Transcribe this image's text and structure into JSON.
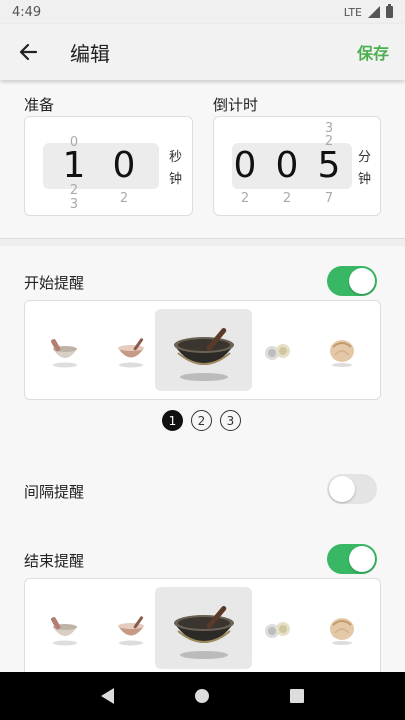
{
  "status": {
    "time": "4:49",
    "network": "LTE"
  },
  "appbar": {
    "title": "编辑",
    "save_label": "保存"
  },
  "prepare": {
    "label": "准备",
    "digits": [
      "1",
      "0"
    ],
    "faint_above": [
      "0",
      ""
    ],
    "faint_below": [
      "2",
      "2"
    ],
    "faint_below2": [
      "3",
      ""
    ],
    "unit": [
      "秒",
      "钟"
    ]
  },
  "countdown": {
    "label": "倒计时",
    "digits": [
      "0",
      "0",
      "5"
    ],
    "faint_above": [
      "",
      "",
      "3"
    ],
    "faint_above2": [
      "",
      "",
      "2"
    ],
    "faint_below": [
      "2",
      "2",
      "7"
    ],
    "unit": [
      "分",
      "钟"
    ]
  },
  "start_reminder": {
    "label": "开始提醒",
    "enabled": true
  },
  "pager": {
    "pages": [
      "1",
      "2",
      "3"
    ],
    "current": 1
  },
  "interval_reminder": {
    "label": "间隔提醒",
    "enabled": false
  },
  "end_reminder": {
    "label": "结束提醒",
    "enabled": true
  },
  "colors": {
    "accent": "#4caf50",
    "toggle_on": "#38b865",
    "toggle_off": "#e4e4e4"
  },
  "sounds": [
    "mortar-bowl",
    "small-singing-bowl",
    "large-singing-bowl",
    "small-bells",
    "shell"
  ]
}
